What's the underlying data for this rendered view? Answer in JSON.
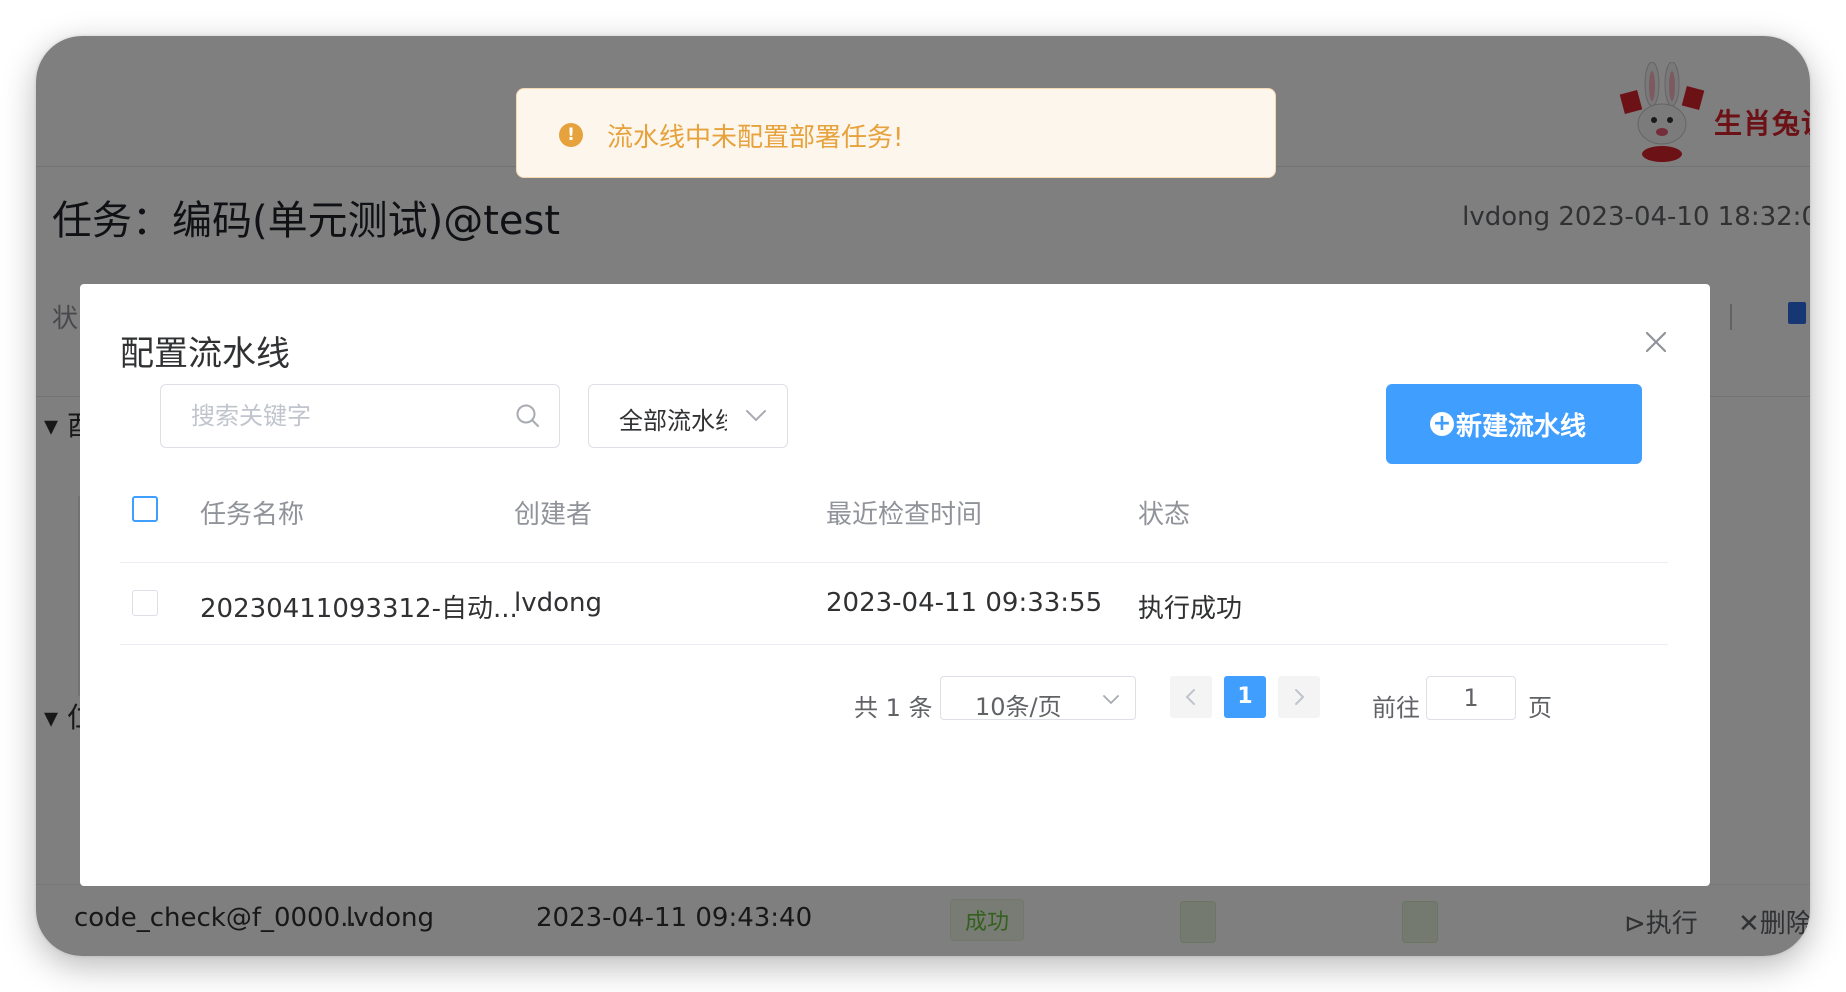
{
  "toast": {
    "text": "流水线中未配置部署任务!"
  },
  "header": {
    "brand": "生肖兔说"
  },
  "page": {
    "title": "任务：编码(单元测试)@test",
    "meta": "lvdong 2023-04-10 18:32:0",
    "state_label": "状",
    "section_a": "酉",
    "section_b": "仁"
  },
  "background_row": {
    "name": "code_check@f_0000...",
    "creator": "lvdong",
    "time": "2023-04-11 09:43:40",
    "status": "成功",
    "run": "⊳执行",
    "delete": "✕删除"
  },
  "dialog": {
    "title": "配置流水线",
    "search": {
      "placeholder": "搜索关键字",
      "value": ""
    },
    "filter": {
      "selected": "全部流水线"
    },
    "new_button": "新建流水线",
    "columns": [
      "任务名称",
      "创建者",
      "最近检查时间",
      "状态"
    ],
    "rows": [
      {
        "name": "20230411093312-自动...",
        "creator": "lvdong",
        "time": "2023-04-11 09:33:55",
        "status": "执行成功"
      }
    ],
    "pagination": {
      "total": "共 1 条",
      "page_size": "10条/页",
      "current": "1",
      "goto_label": "前往",
      "goto_value": "1",
      "unit": "页"
    }
  },
  "colors": {
    "primary": "#409eff",
    "warning": "#e6a23c",
    "warning_bg": "#fdf6ec",
    "success": "#67c23a",
    "brand_red": "#d9232d",
    "overlay": "rgba(0,0,0,0.5)"
  }
}
